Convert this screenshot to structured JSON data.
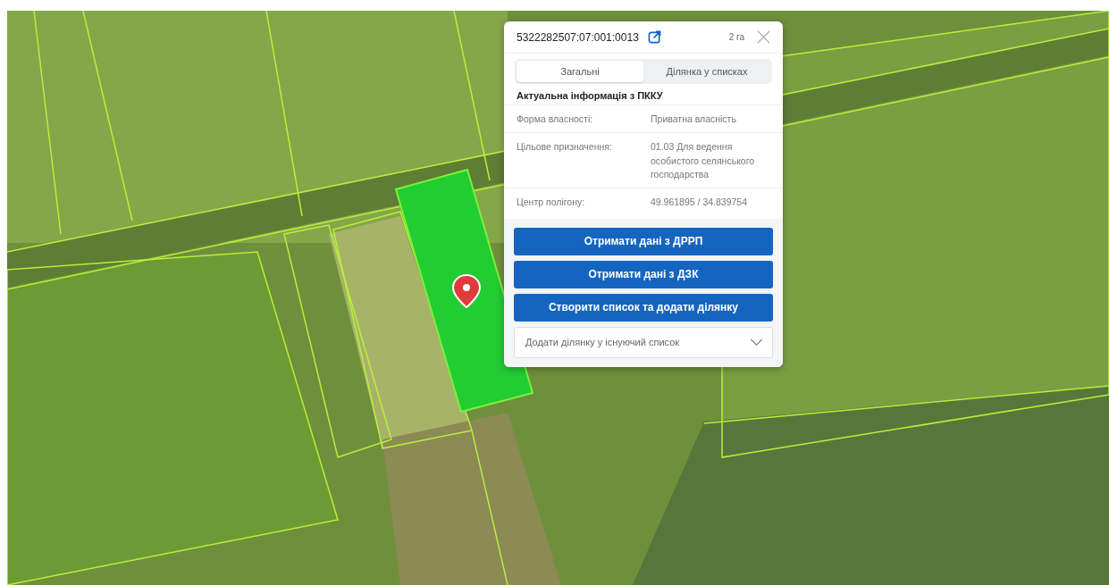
{
  "parcel_popup": {
    "cadastral_number": "5322282507:07:001:0013",
    "area": "2 га",
    "tabs": [
      {
        "label": "Загальні",
        "selected": true
      },
      {
        "label": "Ділянка у списках",
        "selected": false
      }
    ],
    "section_title": "Актуальна інформація з ПККУ",
    "fields": [
      {
        "label": "Форма власності:",
        "value": "Приватна власність"
      },
      {
        "label": "Цільове призначення:",
        "value": "01.03 Для ведення особистого селянського господарства"
      },
      {
        "label": "Центр полігону:",
        "value": "49.961895 / 34.839754"
      }
    ],
    "buttons": [
      "Отримати дані з ДРРП",
      "Отримати дані з ДЗК",
      "Створити список та додати ділянку"
    ],
    "list_select": {
      "placeholder": "Додати ділянку у існуючий список"
    }
  }
}
